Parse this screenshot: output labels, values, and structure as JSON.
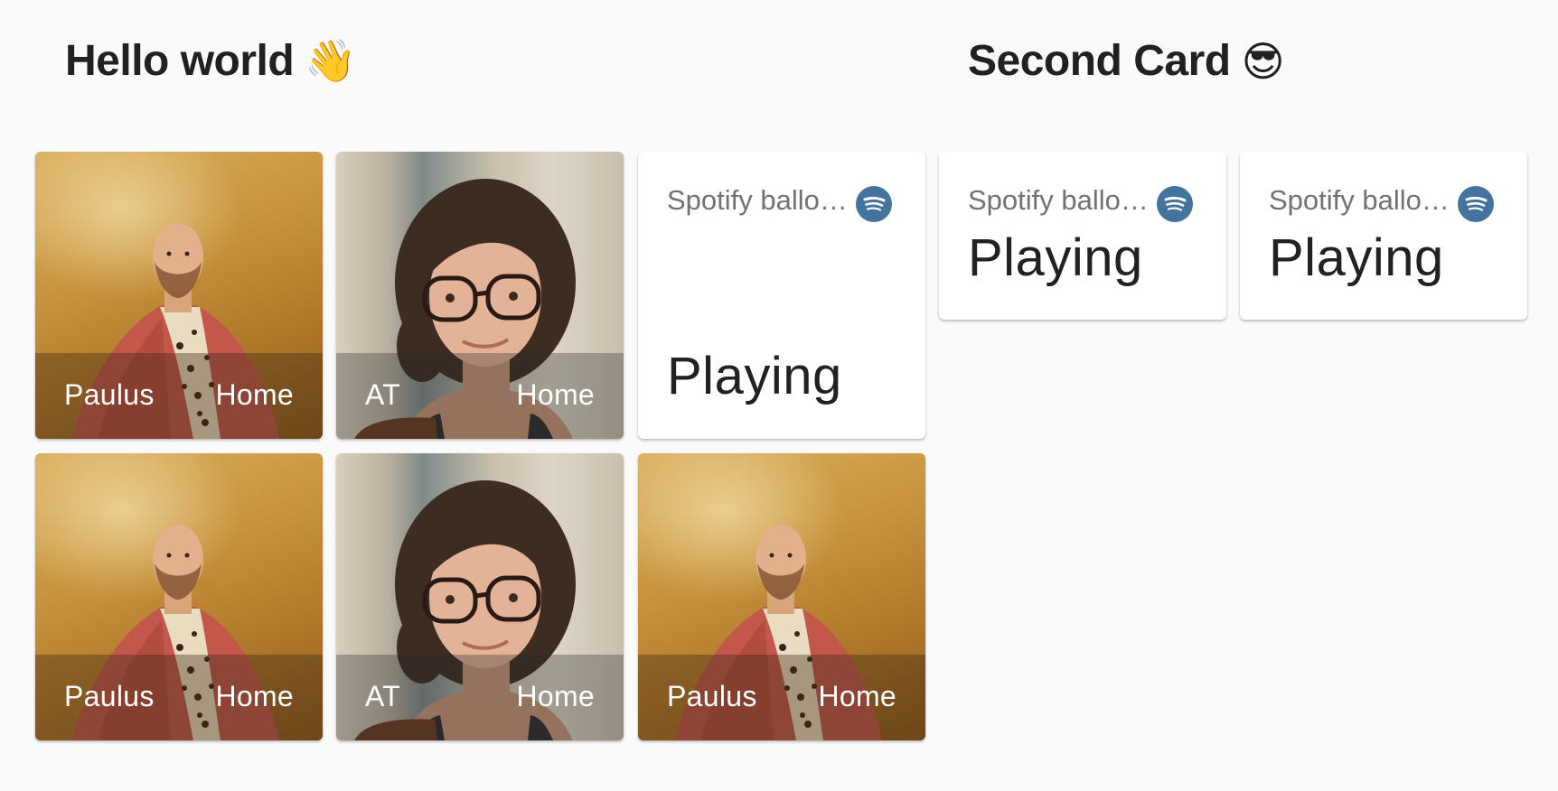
{
  "cards": [
    {
      "title": "Hello world",
      "emoji": "👋",
      "entities": [
        {
          "name": "Paulus",
          "state": "Home",
          "picture": "paulus-photo"
        },
        {
          "name": "AT",
          "state": "Home",
          "picture": "at-photo"
        },
        {
          "media_title": "Spotify ballo…",
          "state": "Playing",
          "icon": "spotify-icon"
        },
        {
          "name": "Paulus",
          "state": "Home",
          "picture": "paulus-photo"
        },
        {
          "name": "AT",
          "state": "Home",
          "picture": "at-photo"
        },
        {
          "name": "Paulus",
          "state": "Home",
          "picture": "paulus-photo"
        }
      ]
    },
    {
      "title": "Second Card",
      "emoji": "😎",
      "entities": [
        {
          "media_title": "Spotify ballo…",
          "state": "Playing",
          "icon": "spotify-icon"
        },
        {
          "media_title": "Spotify ballo…",
          "state": "Playing",
          "icon": "spotify-icon"
        }
      ]
    }
  ],
  "colors": {
    "background": "#fafafa",
    "card": "#ffffff",
    "text_primary": "#212121",
    "text_secondary": "#727272",
    "icon_badge": "#44739e"
  }
}
